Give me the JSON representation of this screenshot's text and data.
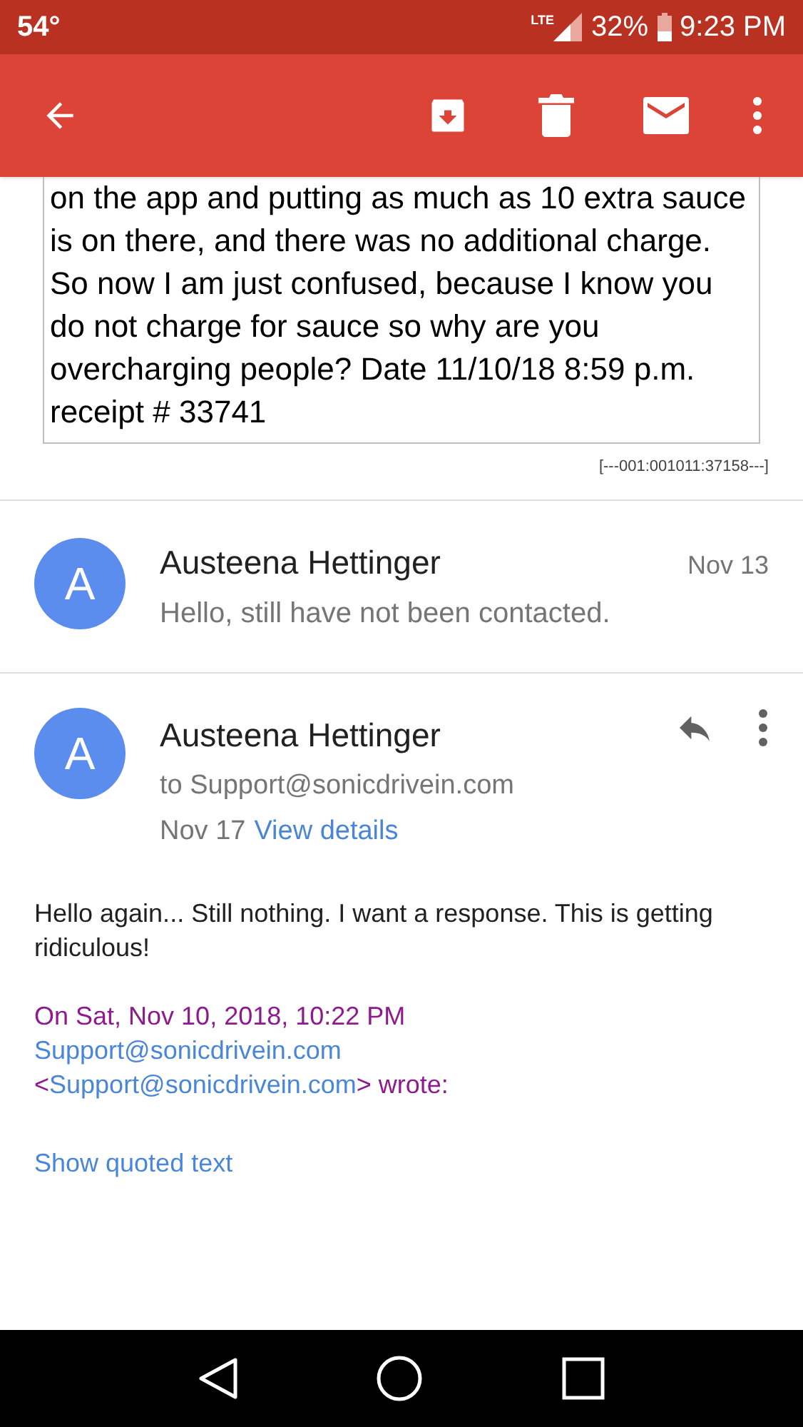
{
  "status_bar": {
    "temperature": "54°",
    "network": "LTE",
    "battery": "32%",
    "time": "9:23 PM"
  },
  "quoted_message": {
    "body": "on the app and putting as much as 10 extra sauce is on there, and there was no additional charge. So now I am just confused, because I know you do not charge for sauce so why are you overcharging people? Date 11/10/18 8:59 p.m. receipt # 33741",
    "reference": "[---001:001011:37158---]"
  },
  "messages": [
    {
      "kind": "collapsed",
      "avatar": "A",
      "sender": "Austeena Hettinger",
      "date": "Nov 13",
      "snippet": "Hello, still have not been contacted."
    },
    {
      "kind": "expanded",
      "avatar": "A",
      "sender": "Austeena Hettinger",
      "to": "to Support@sonicdrivein.com",
      "date": "Nov 17",
      "details_link": "View details",
      "body": "Hello again... Still nothing. I want a response. This is getting ridiculous!",
      "quote": {
        "date_line": "On Sat, Nov 10, 2018, 10:22 PM",
        "sender_link": "Support@sonicdrivein.com",
        "open": "<",
        "address_link": "Support@sonicdrivein.com",
        "close": "> wrote:"
      },
      "show_quoted": "Show quoted text"
    }
  ]
}
